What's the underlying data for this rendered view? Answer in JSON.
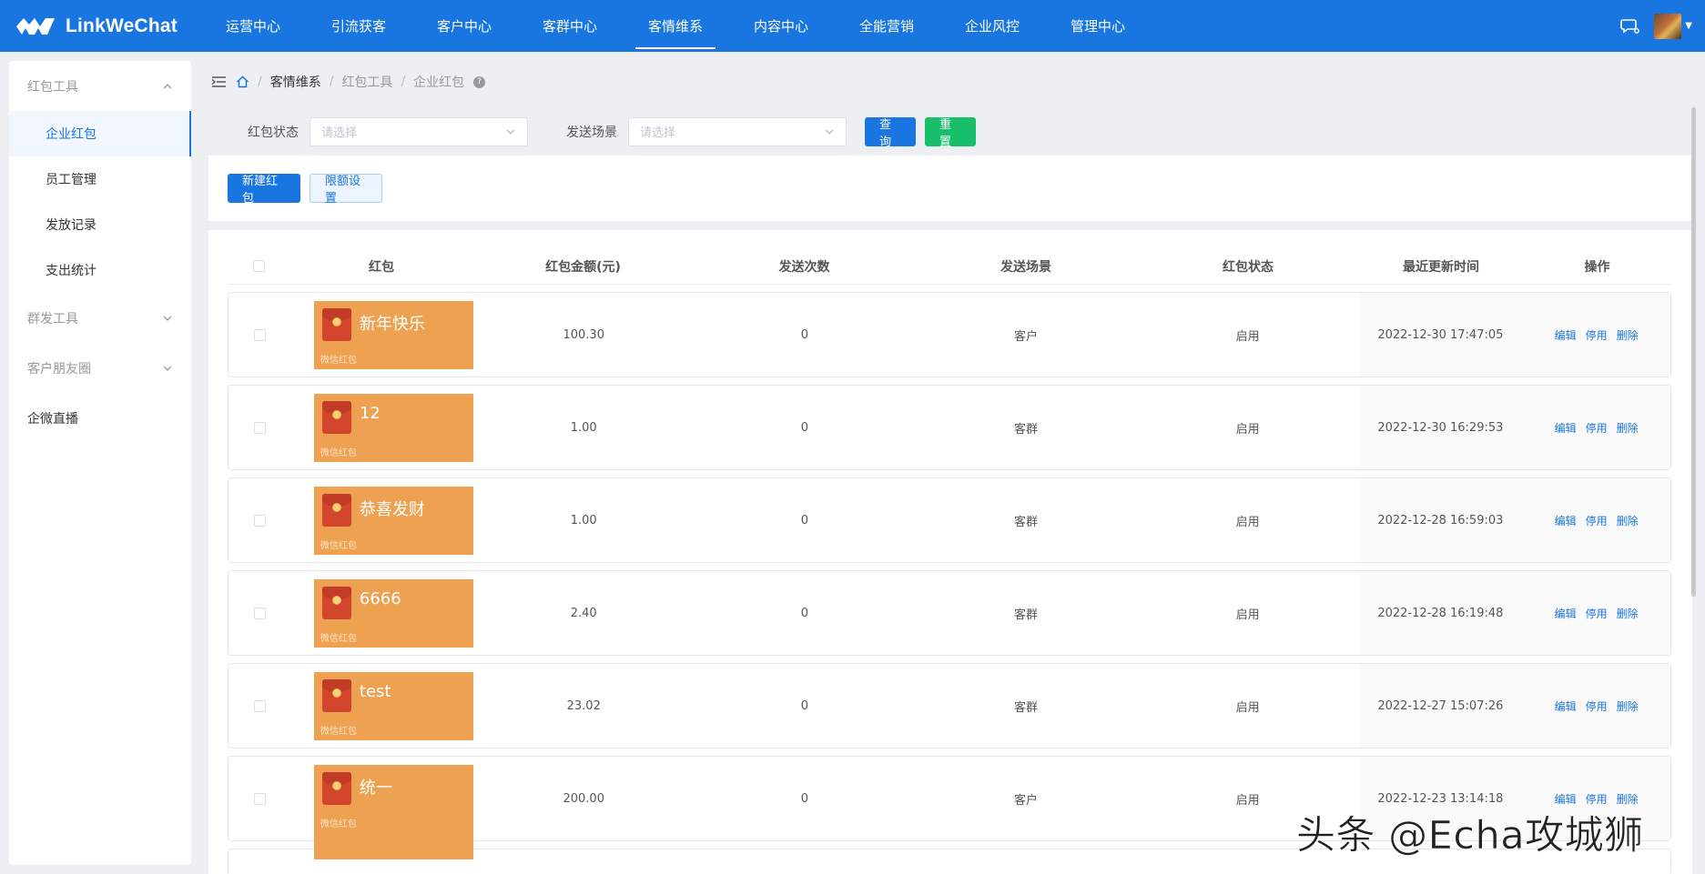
{
  "app": {
    "logo_text": "LinkWeChat"
  },
  "nav": {
    "items": [
      "运营中心",
      "引流获客",
      "客户中心",
      "客群中心",
      "客情维系",
      "内容中心",
      "全能营销",
      "企业风控",
      "管理中心"
    ],
    "active_index": 4
  },
  "sidebar": {
    "group1": "红包工具",
    "sub_items": [
      "企业红包",
      "员工管理",
      "发放记录",
      "支出统计"
    ],
    "group2": "群发工具",
    "group3": "客户朋友圈",
    "top_item": "企微直播"
  },
  "breadcrumb": {
    "c1": "客情维系",
    "c2": "红包工具",
    "c3": "企业红包"
  },
  "filter": {
    "status_label": "红包状态",
    "status_placeholder": "请选择",
    "scene_label": "发送场景",
    "scene_placeholder": "请选择",
    "query_button": "查询",
    "reset_button": "重置"
  },
  "toolbar": {
    "new_button": "新建红包",
    "limit_button": "限额设置"
  },
  "table": {
    "headers": [
      "红包",
      "红包金额(元)",
      "发送次数",
      "发送场景",
      "红包状态",
      "最近更新时间",
      "操作"
    ],
    "card_footer": "微信红包",
    "actions": [
      "编辑",
      "停用",
      "删除"
    ],
    "rows": [
      {
        "name": "新年快乐",
        "amount": "100.30",
        "count": "0",
        "scene": "客户",
        "status": "启用",
        "updated": "2022-12-30 17:47:05"
      },
      {
        "name": "12",
        "amount": "1.00",
        "count": "0",
        "scene": "客群",
        "status": "启用",
        "updated": "2022-12-30 16:29:53"
      },
      {
        "name": "恭喜发财",
        "amount": "1.00",
        "count": "0",
        "scene": "客群",
        "status": "启用",
        "updated": "2022-12-28 16:59:03"
      },
      {
        "name": "6666",
        "amount": "2.40",
        "count": "0",
        "scene": "客群",
        "status": "启用",
        "updated": "2022-12-28 16:19:48"
      },
      {
        "name": "test",
        "amount": "23.02",
        "count": "0",
        "scene": "客群",
        "status": "启用",
        "updated": "2022-12-27 15:07:26"
      },
      {
        "name": "统一",
        "amount": "200.00",
        "count": "0",
        "scene": "客户",
        "status": "启用",
        "updated": "2022-12-23 13:14:18"
      }
    ]
  },
  "watermark": "头条 @Echa攻城狮",
  "colors": {
    "primary": "#1976e0",
    "success": "#19be6b",
    "card": "#eea150"
  }
}
